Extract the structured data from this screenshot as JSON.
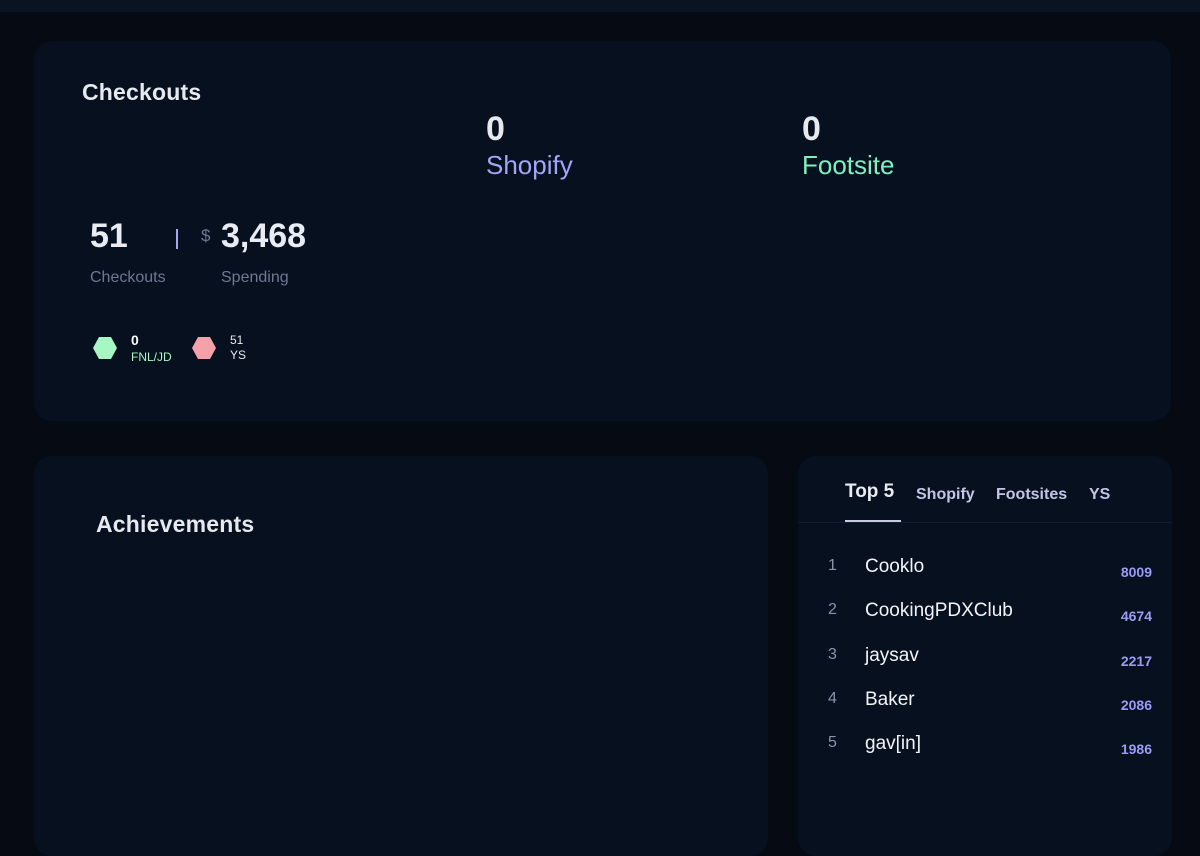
{
  "colors": {
    "background": "#050a13",
    "card": "#07101f",
    "shopify": "#a3a6f5",
    "footsite": "#7ff0c0",
    "fnl_jd": "#a6f7c4",
    "ys": "#f5a1a9",
    "score": "#9a9cf6"
  },
  "checkouts_card": {
    "title": "Checkouts",
    "shopify": {
      "count": "0",
      "label": "Shopify"
    },
    "footsite": {
      "count": "0",
      "label": "Footsite"
    },
    "totals": {
      "checkouts_value": "51",
      "checkouts_label": "Checkouts",
      "currency": "$",
      "spending_value": "3,468",
      "spending_label": "Spending"
    },
    "legend": [
      {
        "count": "0",
        "label": "FNL/JD",
        "icon": "hexagon-icon",
        "color": "#a6f7c4"
      },
      {
        "count": "51",
        "label": "YS",
        "icon": "hexagon-icon",
        "color": "#f5a1a9"
      }
    ]
  },
  "achievements_card": {
    "title": "Achievements"
  },
  "leaderboard": {
    "tabs": [
      "Top 5",
      "Shopify",
      "Footsites",
      "YS"
    ],
    "active_tab": "Top 5",
    "rows": [
      {
        "rank": "1",
        "name": "Cooklo",
        "score": "8009"
      },
      {
        "rank": "2",
        "name": "CookingPDXClub",
        "score": "4674"
      },
      {
        "rank": "3",
        "name": "jaysav",
        "score": "2217"
      },
      {
        "rank": "4",
        "name": "Baker",
        "score": "2086"
      },
      {
        "rank": "5",
        "name": "gav[in]",
        "score": "1986"
      }
    ]
  }
}
